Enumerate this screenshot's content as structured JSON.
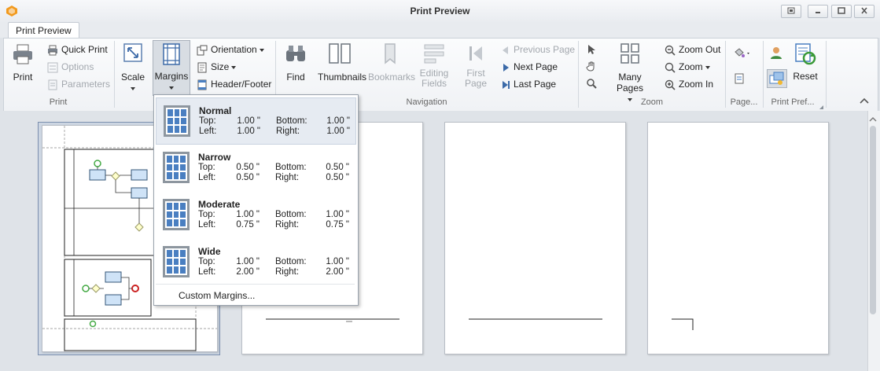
{
  "window": {
    "title": "Print Preview"
  },
  "tabs": [
    {
      "label": "Print Preview"
    }
  ],
  "ribbon": {
    "print_group": {
      "label": "Print",
      "print": "Print",
      "quick_print": "Quick Print",
      "options": "Options",
      "parameters": "Parameters"
    },
    "page_setup": {
      "scale": "Scale",
      "margins": "Margins",
      "orientation": "Orientation",
      "size": "Size",
      "header_footer": "Header/Footer"
    },
    "navigation": {
      "label": "Navigation",
      "find": "Find",
      "thumbnails": "Thumbnails",
      "bookmarks": "Bookmarks",
      "editing_fields_1": "Editing",
      "editing_fields_2": "Fields",
      "first_page_1": "First",
      "first_page_2": "Page",
      "previous_page": "Previous Page",
      "next_page": "Next  Page",
      "last_page": "Last  Page"
    },
    "zoom": {
      "label": "Zoom",
      "many_pages": "Many Pages",
      "zoom_out": "Zoom Out",
      "zoom": "Zoom",
      "zoom_in": "Zoom In"
    },
    "page_bg": {
      "label": "Page..."
    },
    "print_pref": {
      "label": "Print Pref...",
      "reset": "Reset"
    }
  },
  "margins_menu": {
    "options": [
      {
        "name": "Normal",
        "top": "1.00 \"",
        "bottom": "1.00 \"",
        "left": "1.00 \"",
        "right": "1.00 \""
      },
      {
        "name": "Narrow",
        "top": "0.50 \"",
        "bottom": "0.50 \"",
        "left": "0.50 \"",
        "right": "0.50 \""
      },
      {
        "name": "Moderate",
        "top": "1.00 \"",
        "bottom": "1.00 \"",
        "left": "0.75 \"",
        "right": "0.75 \""
      },
      {
        "name": "Wide",
        "top": "1.00 \"",
        "bottom": "1.00 \"",
        "left": "2.00 \"",
        "right": "2.00 \""
      }
    ],
    "labels": {
      "top": "Top:",
      "bottom": "Bottom:",
      "left": "Left:",
      "right": "Right:"
    },
    "custom": "Custom Margins..."
  },
  "colors": {
    "accent": "#4a7fc1",
    "icon_gray": "#6c747d",
    "selected_bg": "#e6ebf2"
  }
}
